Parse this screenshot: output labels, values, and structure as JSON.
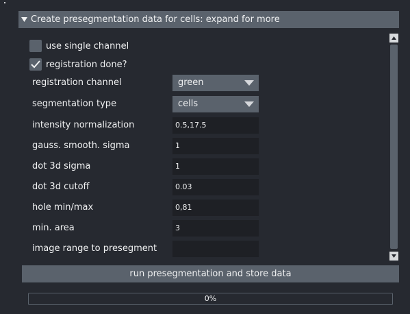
{
  "section": {
    "title": "Create presegmentation data for cells: expand for more",
    "expanded": true
  },
  "checkboxes": [
    {
      "label": "use single channel",
      "checked": false
    },
    {
      "label": "registration done?",
      "checked": true
    }
  ],
  "combos": [
    {
      "label": "registration channel",
      "value": "green"
    },
    {
      "label": "segmentation type",
      "value": "cells"
    }
  ],
  "fields": [
    {
      "label": "intensity normalization",
      "value": "0.5,17.5"
    },
    {
      "label": "gauss. smooth. sigma",
      "value": "1"
    },
    {
      "label": "dot 3d sigma",
      "value": "1"
    },
    {
      "label": "dot 3d cutoff",
      "value": "0.03"
    },
    {
      "label": "hole min/max",
      "value": "0,81"
    },
    {
      "label": "min. area",
      "value": "3"
    },
    {
      "label": "image range to presegment",
      "value": ""
    }
  ],
  "run_button": {
    "label": "run presegmentation and store data"
  },
  "progress": {
    "value": 0,
    "text": "0%"
  },
  "colors": {
    "background": "#262930",
    "widget": "#5a626c",
    "field": "#1e2025",
    "text": "#f0f1f2"
  },
  "icons": {
    "collapse": "triangle-down-icon",
    "check": "checkmark-icon",
    "scroll_up": "arrow-up-icon",
    "scroll_down": "arrow-down-icon"
  }
}
